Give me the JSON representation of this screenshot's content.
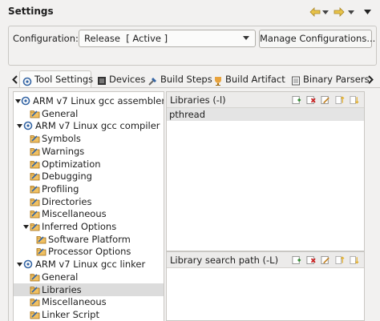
{
  "window": {
    "title": "Settings"
  },
  "nav": {
    "back_icon": "back-arrow-icon",
    "forward_icon": "forward-arrow-icon",
    "menu_icon": "view-menu-icon"
  },
  "config": {
    "label": "Configuration:",
    "selected": "Release  [ Active ]",
    "manage_label": "Manage Configurations..."
  },
  "tabs": [
    {
      "label": "Tool Settings",
      "icon": "tool-settings-icon",
      "active": true
    },
    {
      "label": "Devices",
      "icon": "devices-icon"
    },
    {
      "label": "Build Steps",
      "icon": "build-steps-icon"
    },
    {
      "label": "Build Artifact",
      "icon": "build-artifact-icon"
    },
    {
      "label": "Binary Parsers",
      "icon": "binary-parsers-icon"
    }
  ],
  "tree": [
    {
      "label": "ARM v7 Linux gcc assembler",
      "level": 0,
      "expanded": true,
      "kind": "tool"
    },
    {
      "label": "General",
      "level": 1,
      "kind": "option"
    },
    {
      "label": "ARM v7 Linux gcc compiler",
      "level": 0,
      "expanded": true,
      "kind": "tool"
    },
    {
      "label": "Symbols",
      "level": 1,
      "kind": "option"
    },
    {
      "label": "Warnings",
      "level": 1,
      "kind": "option"
    },
    {
      "label": "Optimization",
      "level": 1,
      "kind": "option"
    },
    {
      "label": "Debugging",
      "level": 1,
      "kind": "option"
    },
    {
      "label": "Profiling",
      "level": 1,
      "kind": "option"
    },
    {
      "label": "Directories",
      "level": 1,
      "kind": "option"
    },
    {
      "label": "Miscellaneous",
      "level": 1,
      "kind": "option"
    },
    {
      "label": "Inferred Options",
      "level": 1,
      "expanded": true,
      "kind": "option"
    },
    {
      "label": "Software Platform",
      "level": 2,
      "kind": "option"
    },
    {
      "label": "Processor Options",
      "level": 2,
      "kind": "option"
    },
    {
      "label": "ARM v7 Linux gcc linker",
      "level": 0,
      "expanded": true,
      "kind": "tool"
    },
    {
      "label": "General",
      "level": 1,
      "kind": "option"
    },
    {
      "label": "Libraries",
      "level": 1,
      "kind": "option",
      "selected": true
    },
    {
      "label": "Miscellaneous",
      "level": 1,
      "kind": "option"
    },
    {
      "label": "Linker Script",
      "level": 1,
      "kind": "option"
    }
  ],
  "libraries": {
    "title": "Libraries (-l)",
    "items": [
      "pthread"
    ],
    "tools": [
      "add-icon",
      "delete-icon",
      "edit-icon",
      "move-up-icon",
      "move-down-icon"
    ]
  },
  "library_search_path": {
    "title": "Library search path (-L)",
    "items": [],
    "tools": [
      "add-icon",
      "delete-icon",
      "edit-icon",
      "move-up-icon",
      "move-down-icon"
    ]
  },
  "colors": {
    "accent_blue": "#3465a4",
    "folder_orange": "#e8a33d",
    "selection": "#dcdcdc"
  }
}
